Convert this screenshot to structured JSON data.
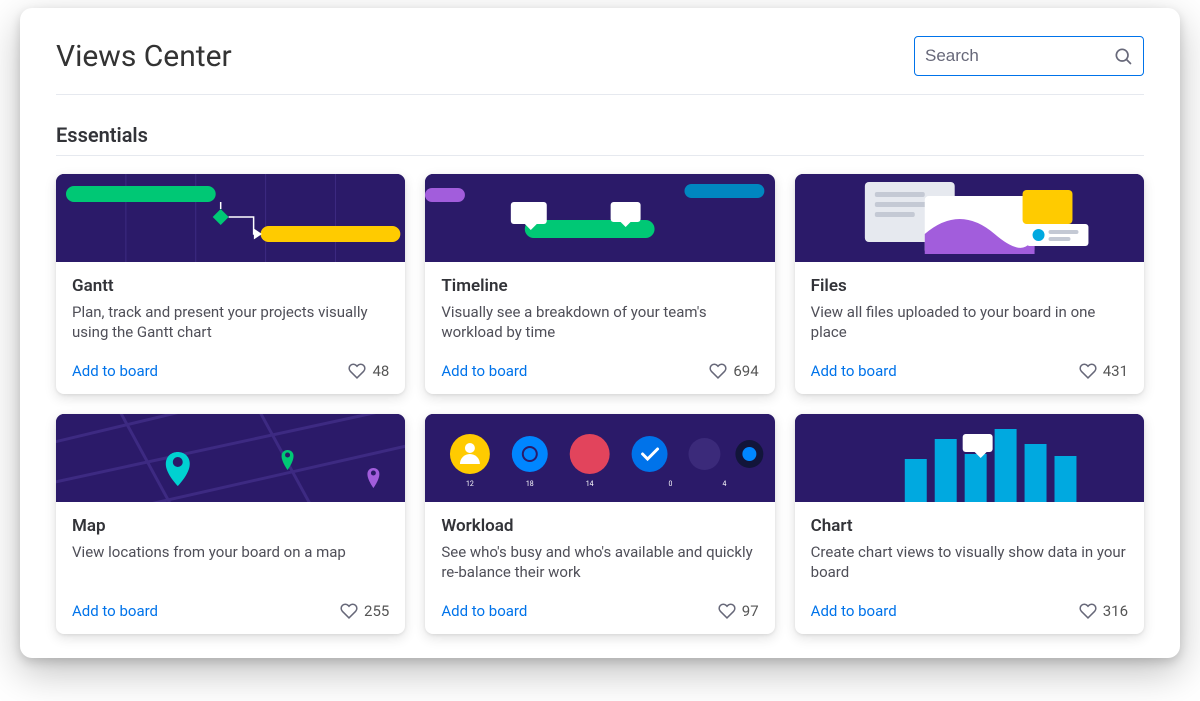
{
  "page_title": "Views Center",
  "search": {
    "placeholder": "Search"
  },
  "section_title": "Essentials",
  "add_label": "Add to board",
  "cards": [
    {
      "title": "Gantt",
      "desc": "Plan, track and present your projects visually using the Gantt chart",
      "likes": "48"
    },
    {
      "title": "Timeline",
      "desc": "Visually see a breakdown of your team's workload by time",
      "likes": "694"
    },
    {
      "title": "Files",
      "desc": "View all files uploaded to your board in one place",
      "likes": "431"
    },
    {
      "title": "Map",
      "desc": "View locations from your board on a map",
      "likes": "255"
    },
    {
      "title": "Workload",
      "desc": "See who's busy and who's available and quickly re-balance their work",
      "likes": "97"
    },
    {
      "title": "Chart",
      "desc": "Create chart views to visually show data in your board",
      "likes": "316"
    }
  ],
  "workload_labels": [
    "12",
    "18",
    "14",
    "0",
    "4"
  ]
}
